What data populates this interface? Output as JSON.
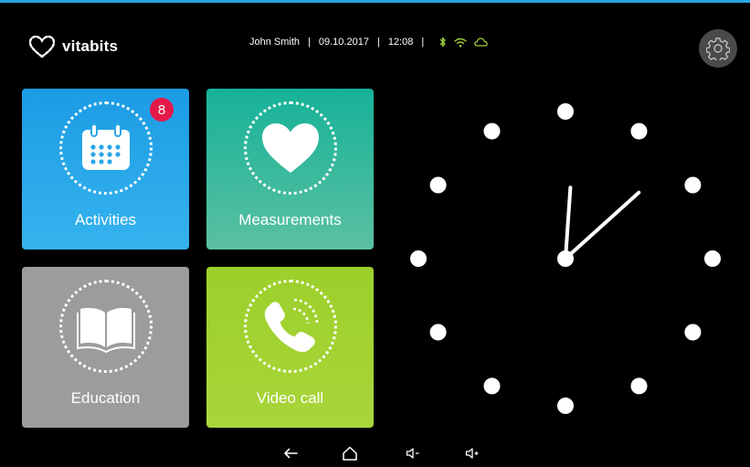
{
  "header": {
    "logo_text": "vitabits",
    "user_name": "John Smith",
    "separator": "|",
    "date": "09.10.2017",
    "time": "12:08",
    "status_icons": [
      "bluetooth-icon",
      "wifi-icon",
      "cloud-icon"
    ]
  },
  "tiles": [
    {
      "label": "Activities",
      "icon": "calendar-icon",
      "badge": "8",
      "color": "#29a8e0"
    },
    {
      "label": "Measurements",
      "icon": "heart-icon",
      "color": "#2eb89a"
    },
    {
      "label": "Education",
      "icon": "book-icon",
      "color": "#9c9c9c"
    },
    {
      "label": "Video call",
      "icon": "phone-icon",
      "color": "#a4d231"
    }
  ],
  "clock": {
    "hours": 12,
    "minutes": 8
  },
  "nav": {
    "icons": [
      "back-icon",
      "home-icon",
      "volume-down-icon",
      "volume-up-icon"
    ]
  },
  "colors": {
    "background": "#000000",
    "accent": "#29a8e0",
    "status_icon": "#9ed23a",
    "badge": "#e5194a"
  }
}
